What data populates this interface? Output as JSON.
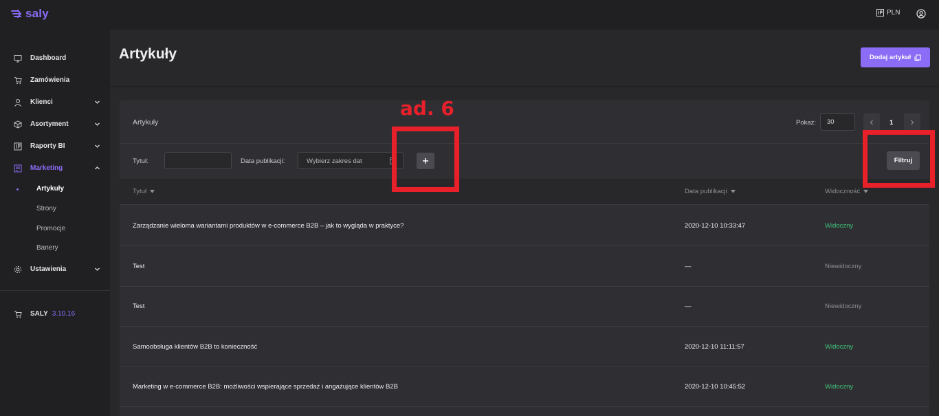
{
  "app": {
    "logo_text": "saly",
    "currency": "PLN",
    "brand_color": "#8b6cf6"
  },
  "sidebar": {
    "items": [
      {
        "label": "Dashboard",
        "icon": "monitor-icon"
      },
      {
        "label": "Zamówienia",
        "icon": "cart-icon"
      },
      {
        "label": "Klienci",
        "icon": "user-icon"
      },
      {
        "label": "Asortyment",
        "icon": "box-icon"
      },
      {
        "label": "Raporty BI",
        "icon": "report-icon"
      },
      {
        "label": "Marketing",
        "icon": "marketing-icon"
      }
    ],
    "marketing_sub": [
      "Artykuły",
      "Strony",
      "Promocje",
      "Banery"
    ],
    "settings_label": "Ustawienia",
    "version_name": "SALY",
    "version_number": "3.10.16"
  },
  "header": {
    "title": "Artykuły",
    "add_button": "Dodaj artykuł"
  },
  "card": {
    "title": "Artykuły",
    "show_label": "Pokaż:",
    "page_size": "30",
    "current_page": "1",
    "filter": {
      "title_label": "Tytuł:",
      "date_label": "Data publikacji:",
      "date_placeholder": "Wybierz zakres dat",
      "filter_button": "Filtruj"
    },
    "columns": [
      "Tytuł",
      "Data publikacji",
      "Widoczność"
    ],
    "rows": [
      {
        "title": "Zarządzanie wieloma wariantami produktów w e-commerce B2B – jak to wygląda w praktyce?",
        "date": "2020-12-10 10:33:47",
        "visibility": "Widoczny",
        "visible": true
      },
      {
        "title": "Test",
        "date": "—",
        "visibility": "Niewidoczny",
        "visible": false
      },
      {
        "title": "Test",
        "date": "—",
        "visibility": "Niewidoczny",
        "visible": false
      },
      {
        "title": "Samoobsługa klientów B2B to konieczność",
        "date": "2020-12-10 11:11:57",
        "visibility": "Widoczny",
        "visible": true
      },
      {
        "title": "Marketing w e-commerce B2B: możliwości wspierające sprzedaż i angażujące klientów B2B",
        "date": "2020-12-10 10:45:52",
        "visibility": "Widoczny",
        "visible": true
      }
    ]
  },
  "annotation": {
    "label": "ad. 6",
    "color": "#e8202a"
  }
}
